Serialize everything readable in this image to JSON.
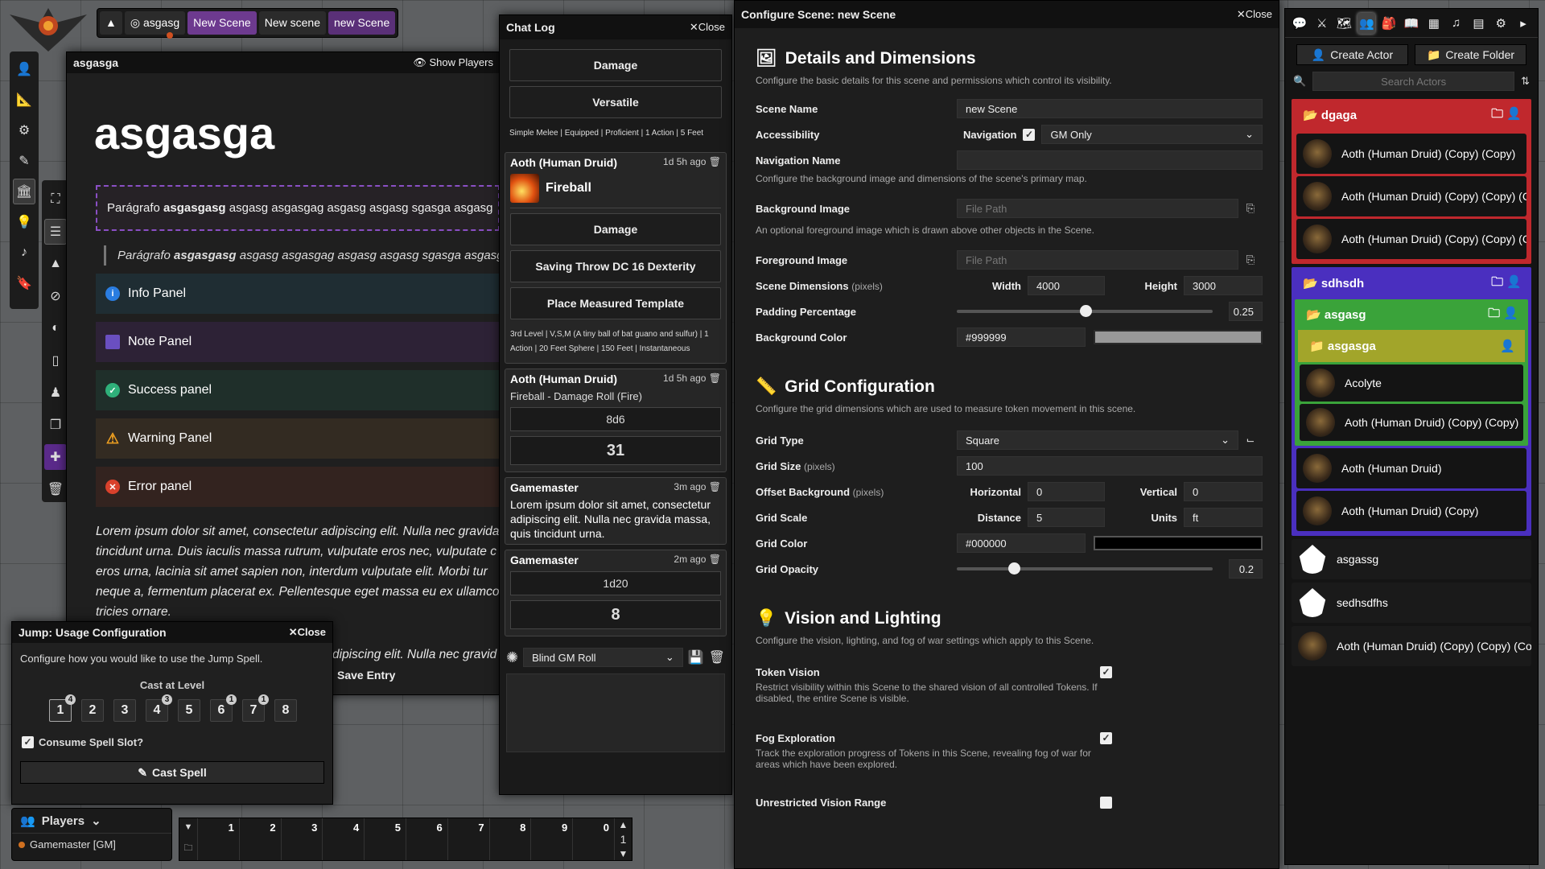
{
  "scene_nav": {
    "user": "asgasg",
    "scenes": [
      "New Scene",
      "New scene",
      "new Scene"
    ]
  },
  "journal": {
    "header": "asgasga",
    "show_players": "Show Players",
    "title": "asgasga",
    "dashed_parts": [
      "Parágrafo ",
      "asgasgasg",
      " asgasg asgasgag asgasg asgasg  sgasga asgasg"
    ],
    "quote_parts": [
      "Parágrafo ",
      "asgasgasg",
      " asgasg asgasgag asgasg asgasg  sgasga asgasg"
    ],
    "panels": [
      "Info Panel",
      "Note Panel",
      "Success panel",
      "Warning Panel",
      "Error panel"
    ],
    "lorem": "Lorem ipsum dolor sit amet, consectetur adipiscing elit. Nulla nec gravida\ntincidunt urna. Duis iaculis massa rutrum, vulputate eros nec, vulputate c\neros urna, lacinia sit amet sapien non, interdum vulputate elit. Morbi tur\nneque a, fermentum placerat ex. Pellentesque eget massa eu ex ullamco\n                                                                    tricies ornare.",
    "lorem2": "dipiscing elit. Nulla nec gravid",
    "save_entry": "Save Entry"
  },
  "chat": {
    "title": "Chat Log",
    "close": "Close",
    "m0": {
      "btn1": "Damage",
      "btn2": "Versatile",
      "tags": "Simple Melee | Equipped | Proficient | 1 Action | 5 Feet"
    },
    "m1": {
      "speaker": "Aoth (Human Druid)",
      "time": "1d 5h ago",
      "spell": "Fireball",
      "btn1": "Damage",
      "btn2": "Saving Throw DC 16 Dexterity",
      "btn3": "Place Measured Template",
      "tags": "3rd Level | V,S,M (A tiny ball of bat guano and sulfur) | 1 Action | 20 Feet Sphere | 150 Feet | Instantaneous"
    },
    "m2": {
      "speaker": "Aoth (Human Druid)",
      "time": "1d 5h ago",
      "flavor": "Fireball - Damage Roll (Fire)",
      "formula": "8d6",
      "total": "31"
    },
    "m3": {
      "speaker": "Gamemaster",
      "time": "3m ago",
      "text": "Lorem ipsum dolor sit amet, consectetur adipiscing elit. Nulla nec gravida massa, quis tincidunt urna."
    },
    "m4": {
      "speaker": "Gamemaster",
      "time": "2m ago",
      "formula": "1d20",
      "total": "8"
    },
    "roll_mode": "Blind GM Roll"
  },
  "config": {
    "title": "Configure Scene: new Scene",
    "close": "Close",
    "details": {
      "title": "Details and Dimensions",
      "hint": "Configure the basic details for this scene and permissions which control its visibility.",
      "scene_name_label": "Scene Name",
      "scene_name": "new Scene",
      "accessibility_label": "Accessibility",
      "navigation_label": "Navigation",
      "access_value": "GM Only",
      "nav_name_label": "Navigation Name",
      "bg_hint": "Configure the background image and dimensions of the scene's primary map.",
      "bg_label": "Background Image",
      "file_path": "File Path",
      "fg_hint": "An optional foreground image which is drawn above other objects in the Scene.",
      "fg_label": "Foreground Image",
      "dims_label": "Scene Dimensions",
      "pixels": "(pixels)",
      "width_label": "Width",
      "width": "4000",
      "height_label": "Height",
      "height": "3000",
      "padding_label": "Padding Percentage",
      "padding": "0.25",
      "bgcolor_label": "Background Color",
      "bgcolor": "#999999"
    },
    "grid": {
      "title": "Grid Configuration",
      "hint": "Configure the grid dimensions which are used to measure token movement in this scene.",
      "type_label": "Grid Type",
      "type": "Square",
      "size_label": "Grid Size",
      "size": "100",
      "offset_label": "Offset Background",
      "horizontal_label": "Horizontal",
      "horizontal": "0",
      "vertical_label": "Vertical",
      "vertical": "0",
      "scale_label": "Grid Scale",
      "distance_label": "Distance",
      "distance": "5",
      "units_label": "Units",
      "units": "ft",
      "color_label": "Grid Color",
      "color": "#000000",
      "opacity_label": "Grid Opacity",
      "opacity": "0.2"
    },
    "vision": {
      "title": "Vision and Lighting",
      "hint": "Configure the vision, lighting, and fog of war settings which apply to this Scene.",
      "token_label": "Token Vision",
      "token_hint": "Restrict visibility within this Scene to the shared vision of all controlled Tokens. If disabled, the entire Scene is visible.",
      "fog_label": "Fog Exploration",
      "fog_hint": "Track the exploration progress of Tokens in this Scene, revealing fog of war for areas which have been explored.",
      "unrestricted_label": "Unrestricted Vision Range"
    }
  },
  "sidebar": {
    "create_actor": "Create Actor",
    "create_folder": "Create Folder",
    "search_placeholder": "Search Actors",
    "f1": {
      "name": "dgaga",
      "actors": [
        "Aoth (Human Druid) (Copy) (Copy)",
        "Aoth (Human Druid) (Copy) (Copy) (C",
        "Aoth (Human Druid) (Copy) (Copy) (C"
      ]
    },
    "f2": {
      "name": "sdhsdh"
    },
    "f3": {
      "name": "asgasg"
    },
    "f4": {
      "name": "asgasga"
    },
    "f3_actors": [
      "Acolyte",
      "Aoth (Human Druid) (Copy) (Copy)"
    ],
    "f2_actors": [
      "Aoth (Human Druid)",
      "Aoth (Human Druid) (Copy)"
    ],
    "loose": [
      "asgassg",
      "sedhsdfhs",
      "Aoth (Human Druid) (Copy) (Copy) (Co"
    ]
  },
  "jump": {
    "title": "Jump: Usage Configuration",
    "close": "Close",
    "hint": "Configure how you would like to use the Jump Spell.",
    "cast_level": "Cast at Level",
    "levels": [
      "1",
      "2",
      "3",
      "4",
      "5",
      "6",
      "7",
      "8"
    ],
    "slots": {
      "1": "4",
      "4": "3",
      "6": "1",
      "7": "1"
    },
    "consume": "Consume Spell Slot?",
    "cast": "Cast Spell"
  },
  "players": {
    "title": "Players",
    "gm": "Gamemaster [GM]"
  },
  "hotbar": {
    "slots": [
      "1",
      "2",
      "3",
      "4",
      "5",
      "6",
      "7",
      "8",
      "9",
      "0"
    ],
    "page": "1"
  },
  "colors": {
    "dgaga": "#c0282d",
    "sdhsdh": "#4a2fbf",
    "asgasg": "#3aa33a",
    "asgasga": "#a2a52a"
  }
}
